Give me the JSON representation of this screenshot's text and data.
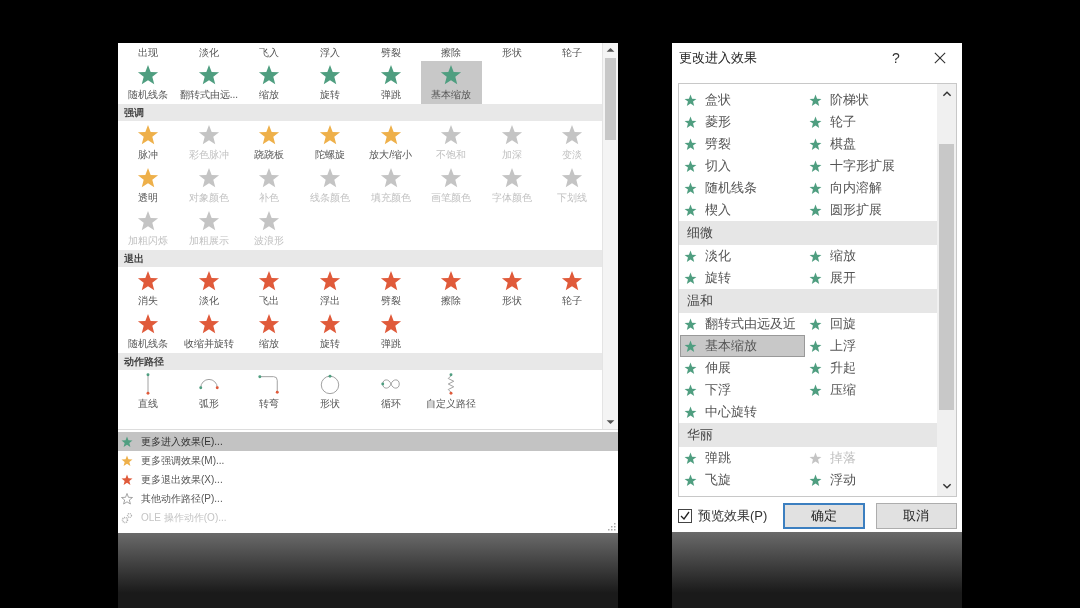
{
  "gallery": {
    "top_labels": [
      "出现",
      "淡化",
      "飞入",
      "浮入",
      "劈裂",
      "擦除",
      "形状",
      "轮子"
    ],
    "sections": [
      {
        "kind": "entrance",
        "items": [
          {
            "label": "随机线条",
            "selected": false,
            "disabled": false
          },
          {
            "label": "翻转式由远...",
            "selected": false,
            "disabled": false
          },
          {
            "label": "缩放",
            "selected": false,
            "disabled": false
          },
          {
            "label": "旋转",
            "selected": false,
            "disabled": false
          },
          {
            "label": "弹跳",
            "selected": false,
            "disabled": false
          },
          {
            "label": "基本缩放",
            "selected": true,
            "disabled": false
          }
        ]
      },
      {
        "kind": "emphasis",
        "title": "强调",
        "items": [
          {
            "label": "脉冲",
            "selected": false,
            "disabled": false
          },
          {
            "label": "彩色脉冲",
            "selected": false,
            "disabled": true
          },
          {
            "label": "跷跷板",
            "selected": false,
            "disabled": false
          },
          {
            "label": "陀螺旋",
            "selected": false,
            "disabled": false
          },
          {
            "label": "放大/缩小",
            "selected": false,
            "disabled": false
          },
          {
            "label": "不饱和",
            "selected": false,
            "disabled": true
          },
          {
            "label": "加深",
            "selected": false,
            "disabled": true
          },
          {
            "label": "变淡",
            "selected": false,
            "disabled": true
          },
          {
            "label": "透明",
            "selected": false,
            "disabled": false
          },
          {
            "label": "对象颜色",
            "selected": false,
            "disabled": true
          },
          {
            "label": "补色",
            "selected": false,
            "disabled": true
          },
          {
            "label": "线条颜色",
            "selected": false,
            "disabled": true
          },
          {
            "label": "填充颜色",
            "selected": false,
            "disabled": true
          },
          {
            "label": "画笔颜色",
            "selected": false,
            "disabled": true
          },
          {
            "label": "字体颜色",
            "selected": false,
            "disabled": true
          },
          {
            "label": "下划线",
            "selected": false,
            "disabled": true
          },
          {
            "label": "加粗闪烁",
            "selected": false,
            "disabled": true
          },
          {
            "label": "加粗展示",
            "selected": false,
            "disabled": true
          },
          {
            "label": "波浪形",
            "selected": false,
            "disabled": true
          }
        ]
      },
      {
        "kind": "exit",
        "title": "退出",
        "items": [
          {
            "label": "消失",
            "selected": false,
            "disabled": false
          },
          {
            "label": "淡化",
            "selected": false,
            "disabled": false
          },
          {
            "label": "飞出",
            "selected": false,
            "disabled": false
          },
          {
            "label": "浮出",
            "selected": false,
            "disabled": false
          },
          {
            "label": "劈裂",
            "selected": false,
            "disabled": false
          },
          {
            "label": "擦除",
            "selected": false,
            "disabled": false
          },
          {
            "label": "形状",
            "selected": false,
            "disabled": false
          },
          {
            "label": "轮子",
            "selected": false,
            "disabled": false
          },
          {
            "label": "随机线条",
            "selected": false,
            "disabled": false
          },
          {
            "label": "收缩并旋转",
            "selected": false,
            "disabled": false
          },
          {
            "label": "缩放",
            "selected": false,
            "disabled": false
          },
          {
            "label": "旋转",
            "selected": false,
            "disabled": false
          },
          {
            "label": "弹跳",
            "selected": false,
            "disabled": false
          }
        ]
      },
      {
        "kind": "path",
        "title": "动作路径",
        "items": [
          {
            "label": "直线",
            "kind": "line",
            "selected": false,
            "disabled": false
          },
          {
            "label": "弧形",
            "kind": "arc",
            "selected": false,
            "disabled": false
          },
          {
            "label": "转弯",
            "kind": "turn",
            "selected": false,
            "disabled": false
          },
          {
            "label": "形状",
            "kind": "circle",
            "selected": false,
            "disabled": false
          },
          {
            "label": "循环",
            "kind": "loop",
            "selected": false,
            "disabled": false
          },
          {
            "label": "自定义路径",
            "kind": "custom",
            "selected": false,
            "disabled": false
          }
        ]
      }
    ]
  },
  "menu": [
    {
      "label": "更多进入效果(E)...",
      "kind": "entrance",
      "selected": true,
      "disabled": false
    },
    {
      "label": "更多强调效果(M)...",
      "kind": "emphasis",
      "selected": false,
      "disabled": false
    },
    {
      "label": "更多退出效果(X)...",
      "kind": "exit",
      "selected": false,
      "disabled": false
    },
    {
      "label": "其他动作路径(P)...",
      "kind": "outline",
      "selected": false,
      "disabled": false
    },
    {
      "label": "OLE 操作动作(O)...",
      "kind": "gear",
      "selected": false,
      "disabled": true
    }
  ],
  "dialog": {
    "title": "更改进入效果",
    "help": "?",
    "groups": [
      {
        "items": [
          {
            "label": "盒状",
            "selected": false,
            "disabled": false
          },
          {
            "label": "阶梯状",
            "selected": false,
            "disabled": false
          },
          {
            "label": "菱形",
            "selected": false,
            "disabled": false
          },
          {
            "label": "轮子",
            "selected": false,
            "disabled": false
          },
          {
            "label": "劈裂",
            "selected": false,
            "disabled": false
          },
          {
            "label": "棋盘",
            "selected": false,
            "disabled": false
          },
          {
            "label": "切入",
            "selected": false,
            "disabled": false
          },
          {
            "label": "十字形扩展",
            "selected": false,
            "disabled": false
          },
          {
            "label": "随机线条",
            "selected": false,
            "disabled": false
          },
          {
            "label": "向内溶解",
            "selected": false,
            "disabled": false
          },
          {
            "label": "楔入",
            "selected": false,
            "disabled": false
          },
          {
            "label": "圆形扩展",
            "selected": false,
            "disabled": false
          }
        ]
      },
      {
        "title": "细微",
        "items": [
          {
            "label": "淡化",
            "selected": false,
            "disabled": false
          },
          {
            "label": "缩放",
            "selected": false,
            "disabled": false
          },
          {
            "label": "旋转",
            "selected": false,
            "disabled": false
          },
          {
            "label": "展开",
            "selected": false,
            "disabled": false
          }
        ]
      },
      {
        "title": "温和",
        "items": [
          {
            "label": "翻转式由远及近",
            "selected": false,
            "disabled": false
          },
          {
            "label": "回旋",
            "selected": false,
            "disabled": false
          },
          {
            "label": "基本缩放",
            "selected": true,
            "disabled": false
          },
          {
            "label": "上浮",
            "selected": false,
            "disabled": false
          },
          {
            "label": "伸展",
            "selected": false,
            "disabled": false
          },
          {
            "label": "升起",
            "selected": false,
            "disabled": false
          },
          {
            "label": "下浮",
            "selected": false,
            "disabled": false
          },
          {
            "label": "压缩",
            "selected": false,
            "disabled": false
          },
          {
            "label": "中心旋转",
            "selected": false,
            "disabled": false
          }
        ]
      },
      {
        "title": "华丽",
        "items": [
          {
            "label": "弹跳",
            "selected": false,
            "disabled": false
          },
          {
            "label": "掉落",
            "selected": false,
            "disabled": true
          },
          {
            "label": "飞旋",
            "selected": false,
            "disabled": false
          },
          {
            "label": "浮动",
            "selected": false,
            "disabled": false
          }
        ]
      }
    ],
    "preview": {
      "label": "预览效果(P)",
      "checked": true
    },
    "buttons": [
      {
        "label": "确定",
        "default": true
      },
      {
        "label": "取消",
        "default": false
      }
    ]
  }
}
